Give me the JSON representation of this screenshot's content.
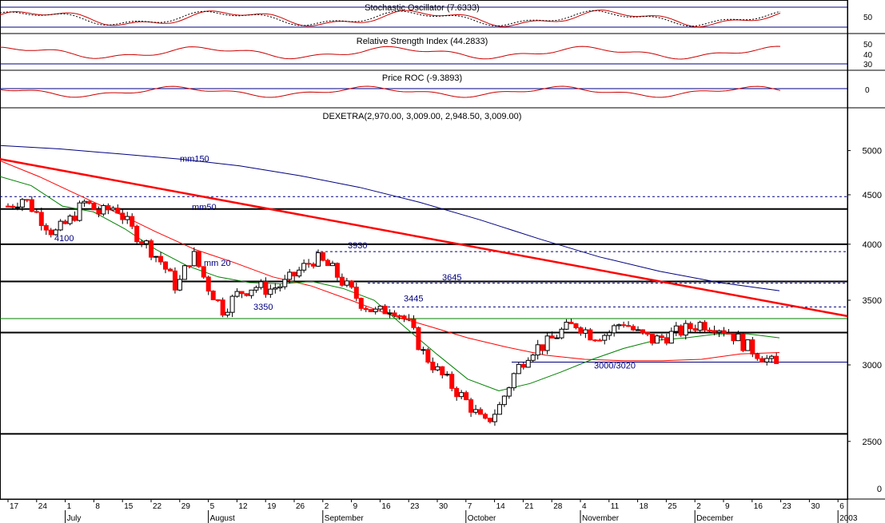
{
  "panels": {
    "stochastic": {
      "title": "Stochastic Oscillator (7.6333)",
      "ticks": [
        "50"
      ]
    },
    "rsi": {
      "title": "Relative Strength Index (44.2833)",
      "ticks": [
        "50",
        "40",
        "30"
      ]
    },
    "roc": {
      "title": "Price ROC (-9.3893)",
      "ticks": [
        "0"
      ]
    },
    "price": {
      "title": "DEXETRA(2,970.00, 3,009.00, 2,948.50, 3,009.00)"
    }
  },
  "colors": {
    "up_candle": "#ffffff",
    "down_candle": "#ff0000",
    "mm20": "#008000",
    "mm50": "#ff0000",
    "mm150": "#000080",
    "trendline": "#ff0000",
    "label": "#000080",
    "indicator": "#cc0000",
    "grid": "#000000"
  },
  "chart_data": {
    "type": "candlestick",
    "y_scale": "log",
    "y_ticks": [
      2500,
      3000,
      3500,
      4000,
      4500,
      5000
    ],
    "y_extra_tick": "0",
    "x_ticks": [
      "17",
      "24",
      "1",
      "8",
      "15",
      "22",
      "29",
      "5",
      "12",
      "19",
      "26",
      "2",
      "9",
      "16",
      "23",
      "30",
      "7",
      "14",
      "21",
      "28",
      "4",
      "11",
      "18",
      "25",
      "2",
      "9",
      "16",
      "23",
      "30",
      "6"
    ],
    "months": [
      "July",
      "August",
      "September",
      "October",
      "November",
      "December",
      "2003"
    ],
    "support_resistance": [
      {
        "value": 4350,
        "style": "solid"
      },
      {
        "value": 4000,
        "style": "solid"
      },
      {
        "value": 3660,
        "style": "solid"
      },
      {
        "value": 3240,
        "style": "solid"
      },
      {
        "value": 2545,
        "style": "solid"
      },
      {
        "value": 4480,
        "style": "dashed"
      },
      {
        "value": 3930,
        "style": "dashed"
      },
      {
        "value": 3645,
        "style": "dashed"
      },
      {
        "value": 3445,
        "style": "dashed"
      },
      {
        "value": 3350,
        "style": "thin"
      },
      {
        "value": 3020,
        "style": "thin"
      }
    ],
    "annotations": [
      {
        "text": "mm150",
        "value": 4870
      },
      {
        "text": "mm50",
        "value": 4340
      },
      {
        "text": "4100",
        "value": 4030
      },
      {
        "text": "3930",
        "value": 3960
      },
      {
        "text": "mm 20",
        "value": 3800
      },
      {
        "text": "3645",
        "value": 3670
      },
      {
        "text": "3445",
        "value": 3490
      },
      {
        "text": "3350",
        "value": 3420
      },
      {
        "text": "3000/3020",
        "value": 2975
      }
    ],
    "trendline": {
      "from": 4900,
      "to": 3370
    },
    "ohlc_anchors": [
      4380,
      4470,
      4280,
      4100,
      4230,
      4420,
      4300,
      4380,
      4150,
      4000,
      3830,
      3600,
      3920,
      3620,
      3420,
      3560,
      3620,
      3590,
      3640,
      3760,
      3870,
      3780,
      3620,
      3480,
      3390,
      3450,
      3320,
      3090,
      2950,
      2840,
      2730,
      2600,
      2720,
      2950,
      3110,
      3150,
      3250,
      3310,
      3220,
      3230,
      3330,
      3230,
      3180,
      3220,
      3260,
      3310,
      3300,
      3240,
      3140,
      3070,
      2990
    ],
    "closes": [
      3009
    ],
    "mm20": [
      4700,
      4600,
      4380,
      4320,
      4150,
      3950,
      3800,
      3700,
      3650,
      3640,
      3660,
      3600,
      3500,
      3280,
      3080,
      2900,
      2820,
      2870,
      2950,
      3040,
      3120,
      3180,
      3200,
      3230,
      3230,
      3200
    ],
    "mm50": [
      4880,
      4700,
      4500,
      4310,
      4120,
      3950,
      3830,
      3700,
      3620,
      3500,
      3380,
      3290,
      3200,
      3130,
      3070,
      3040,
      3030,
      3030,
      3040,
      3080,
      3090
    ],
    "mm150": [
      5060,
      5020,
      4960,
      4900,
      4820,
      4710,
      4580,
      4420,
      4240,
      4050,
      3880,
      3750,
      3650,
      3580
    ]
  }
}
